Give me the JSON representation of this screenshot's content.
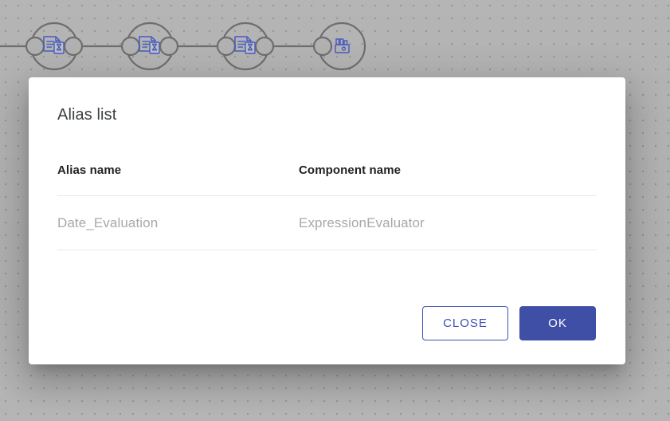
{
  "canvas": {
    "background_color": "#b1b1b1",
    "grid_dot_color": "#787a7c",
    "node_stroke_color": "#6e6e6e",
    "node_icon_color": "#4a5bbf",
    "nodes": [
      {
        "id": "node-1",
        "icon": "document-hourglass-icon",
        "has_input_port": true,
        "has_output_port": true
      },
      {
        "id": "node-2",
        "icon": "document-hourglass-icon",
        "has_input_port": true,
        "has_output_port": true
      },
      {
        "id": "node-3",
        "icon": "document-hourglass-icon",
        "has_input_port": true,
        "has_output_port": true
      },
      {
        "id": "node-4",
        "icon": "database-output-icon",
        "has_input_port": true,
        "has_output_port": false
      }
    ]
  },
  "dialog": {
    "title": "Alias list",
    "table": {
      "columns": [
        {
          "key": "alias_name",
          "label": "Alias name"
        },
        {
          "key": "component_name",
          "label": "Component name"
        }
      ],
      "rows": [
        {
          "alias_name": "Date_Evaluation",
          "component_name": "ExpressionEvaluator"
        }
      ]
    },
    "actions": {
      "close_label": "CLOSE",
      "ok_label": "OK",
      "close_color": "#3f51b5",
      "ok_background": "#3f4fa5",
      "ok_text_color": "#ffffff"
    }
  }
}
